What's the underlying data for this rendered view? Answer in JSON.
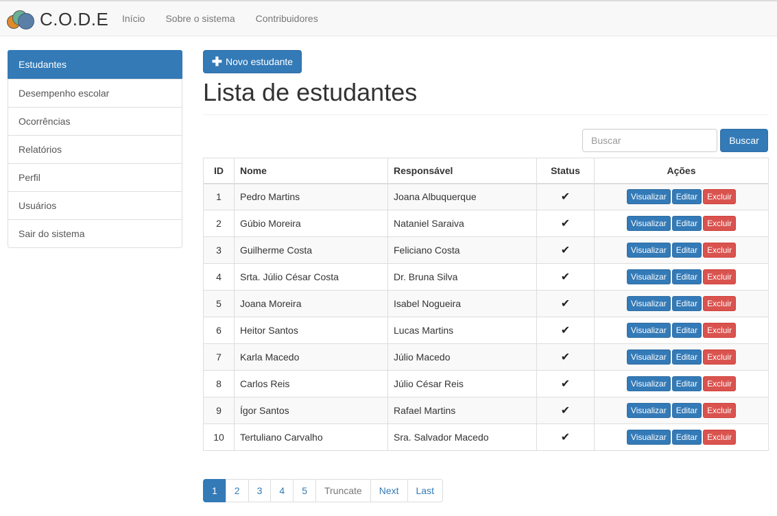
{
  "navbar": {
    "brand": "C.O.D.E",
    "links": [
      {
        "label": "Início"
      },
      {
        "label": "Sobre o sistema"
      },
      {
        "label": "Contribuidores"
      }
    ]
  },
  "sidebar": {
    "items": [
      {
        "label": "Estudantes",
        "active": true
      },
      {
        "label": "Desempenho escolar"
      },
      {
        "label": "Ocorrências"
      },
      {
        "label": "Relatórios"
      },
      {
        "label": "Perfil"
      },
      {
        "label": "Usuários"
      },
      {
        "label": "Sair do sistema"
      }
    ]
  },
  "main": {
    "new_button": "Novo estudante",
    "new_button_icon": "plus-icon",
    "title": "Lista de estudantes",
    "search": {
      "placeholder": "Buscar",
      "value": "",
      "button": "Buscar"
    },
    "table": {
      "headers": [
        "ID",
        "Nome",
        "Responsável",
        "Status",
        "Ações"
      ],
      "status_icon": "check-icon",
      "actions": {
        "view": "Visualizar",
        "edit": "Editar",
        "delete": "Excluir"
      },
      "rows": [
        {
          "id": "1",
          "nome": "Pedro Martins",
          "responsavel": "Joana Albuquerque",
          "status": "✔"
        },
        {
          "id": "2",
          "nome": "Gúbio Moreira",
          "responsavel": "Nataniel Saraiva",
          "status": "✔"
        },
        {
          "id": "3",
          "nome": "Guilherme Costa",
          "responsavel": "Feliciano Costa",
          "status": "✔"
        },
        {
          "id": "4",
          "nome": "Srta. Júlio César Costa",
          "responsavel": "Dr. Bruna Silva",
          "status": "✔"
        },
        {
          "id": "5",
          "nome": "Joana Moreira",
          "responsavel": "Isabel Nogueira",
          "status": "✔"
        },
        {
          "id": "6",
          "nome": "Heitor Santos",
          "responsavel": "Lucas Martins",
          "status": "✔"
        },
        {
          "id": "7",
          "nome": "Karla Macedo",
          "responsavel": "Júlio Macedo",
          "status": "✔"
        },
        {
          "id": "8",
          "nome": "Carlos Reis",
          "responsavel": "Júlio César Reis",
          "status": "✔"
        },
        {
          "id": "9",
          "nome": "Ígor Santos",
          "responsavel": "Rafael Martins",
          "status": "✔"
        },
        {
          "id": "10",
          "nome": "Tertuliano Carvalho",
          "responsavel": "Sra. Salvador Macedo",
          "status": "✔"
        }
      ]
    },
    "pagination": [
      {
        "label": "1",
        "active": true
      },
      {
        "label": "2"
      },
      {
        "label": "3"
      },
      {
        "label": "4"
      },
      {
        "label": "5"
      },
      {
        "label": "Truncate",
        "disabled": true
      },
      {
        "label": "Next"
      },
      {
        "label": "Last"
      }
    ]
  },
  "colors": {
    "primary": "#337ab7",
    "danger": "#d9534f",
    "logo": [
      "#e08a2a",
      "#6aaf94",
      "#5a80a8"
    ]
  }
}
